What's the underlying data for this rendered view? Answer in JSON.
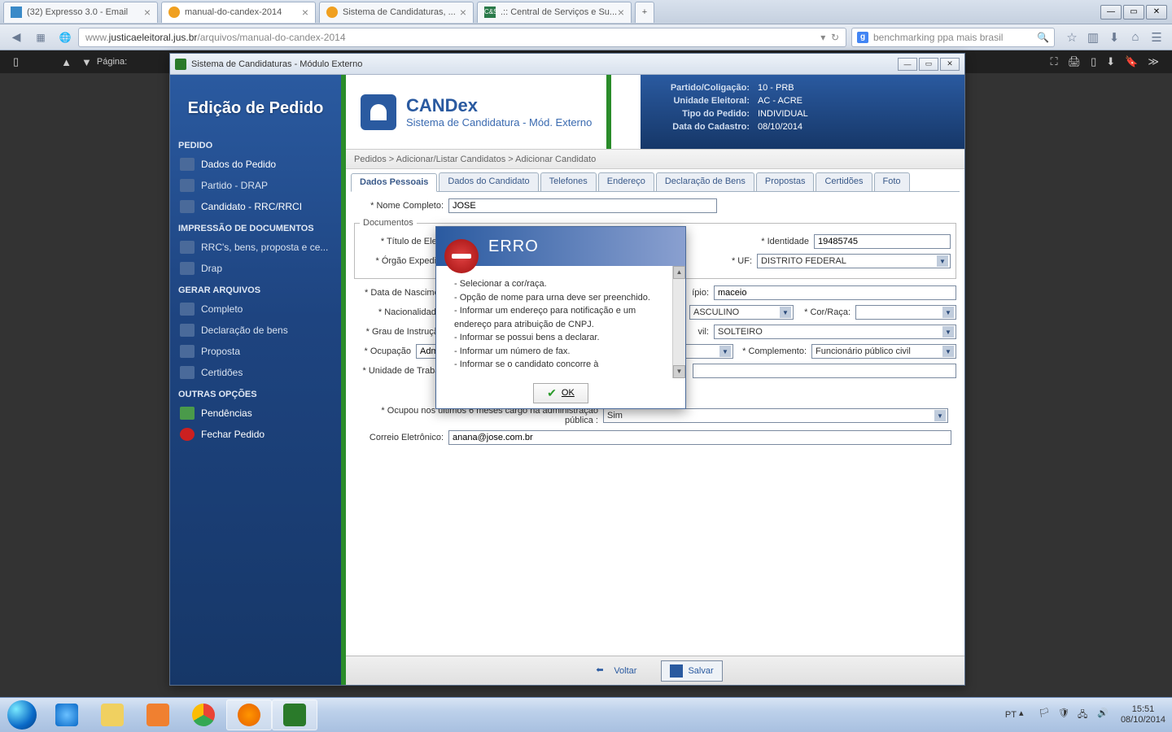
{
  "browser": {
    "tabs": [
      {
        "title": "(32) Expresso 3.0 - Email"
      },
      {
        "title": "manual-do-candex-2014"
      },
      {
        "title": "Sistema de Candidaturas, ..."
      },
      {
        "title": ".:: Central de Serviços e Su..."
      }
    ],
    "url_prefix": "www.",
    "url_domain": "justicaeleitoral.jus.br",
    "url_path": "/arquivos/manual-do-candex-2014",
    "search": "benchmarking ppa mais brasil",
    "page_label": "Página:"
  },
  "window": {
    "title": "Sistema de Candidaturas - Módulo Externo"
  },
  "sidebar": {
    "title": "Edição de Pedido",
    "sections": {
      "pedido": {
        "label": "PEDIDO",
        "items": [
          "Dados do Pedido",
          "Partido - DRAP",
          "Candidato - RRC/RRCI"
        ]
      },
      "impressao": {
        "label": "IMPRESSÃO DE DOCUMENTOS",
        "items": [
          "RRC's, bens, proposta e ce...",
          "Drap"
        ]
      },
      "gerar": {
        "label": "GERAR ARQUIVOS",
        "items": [
          "Completo",
          "Declaração de bens",
          "Proposta",
          "Certidões"
        ]
      },
      "outras": {
        "label": "OUTRAS OPÇÕES",
        "items": [
          "Pendências",
          "Fechar Pedido"
        ]
      }
    }
  },
  "header": {
    "app_name": "CANDex",
    "app_sub": "Sistema de Candidatura - Mód. Externo",
    "info": {
      "partido_label": "Partido/Coligação:",
      "partido": "10 - PRB",
      "unidade_label": "Unidade Eleitoral:",
      "unidade": "AC - ACRE",
      "tipo_label": "Tipo do Pedido:",
      "tipo": "INDIVIDUAL",
      "data_label": "Data do Cadastro:",
      "data": "08/10/2014"
    }
  },
  "breadcrumb": "Pedidos > Adicionar/Listar Candidatos > Adicionar Candidato",
  "tabs": [
    "Dados Pessoais",
    "Dados do Candidato",
    "Telefones",
    "Endereço",
    "Declaração de Bens",
    "Propostas",
    "Certidões",
    "Foto"
  ],
  "form": {
    "nome_completo_label": "* Nome Completo:",
    "nome_completo": "JOSE",
    "documentos_legend": "Documentos",
    "titulo_label": "* Título de Eleitor",
    "identidade_label": "* Identidade",
    "identidade": "19485745",
    "orgao_label": "* Órgão Expedidor",
    "uf_label": "* UF:",
    "uf": "DISTRITO FEDERAL",
    "data_nasc_label": "* Data de Nascimento",
    "municipio_partial_label": "ípio:",
    "municipio": "maceio",
    "nacionalidade_label": "* Nacionalidade:",
    "sexo_partial": "ASCULINO",
    "cor_label": "* Cor/Raça:",
    "grau_label": "* Grau de Instrução",
    "civil_partial_label": "vil:",
    "civil": "SOLTEIRO",
    "ocupacao_label": "* Ocupação",
    "ocupacao": "Admini",
    "complemento_label": "* Complemento:",
    "complemento": "Funcionário público civil",
    "unidade_trab_label": "* Unidade de Trabalho",
    "ocupou_label": "* Ocupou nos últimos 6 meses cargo na administração pública :",
    "ocupou": "Sim",
    "correio_label": "Correio Eletrônico:",
    "correio": "anana@jose.com.br"
  },
  "error": {
    "title": "ERRO",
    "lines": [
      "- Selecionar a cor/raça.",
      "- Opção de nome para urna deve ser preenchido.",
      "- Informar um endereço para notificação e um endereço para atribuição de CNPJ.",
      "- Informar se possui bens a declarar.",
      "- Informar um número de fax.",
      "- Informar se o candidato concorre à"
    ],
    "ok": "OK"
  },
  "footer": {
    "voltar": "Voltar",
    "salvar": "Salvar"
  },
  "tray": {
    "lang": "PT",
    "time": "15:51",
    "date": "08/10/2014"
  }
}
